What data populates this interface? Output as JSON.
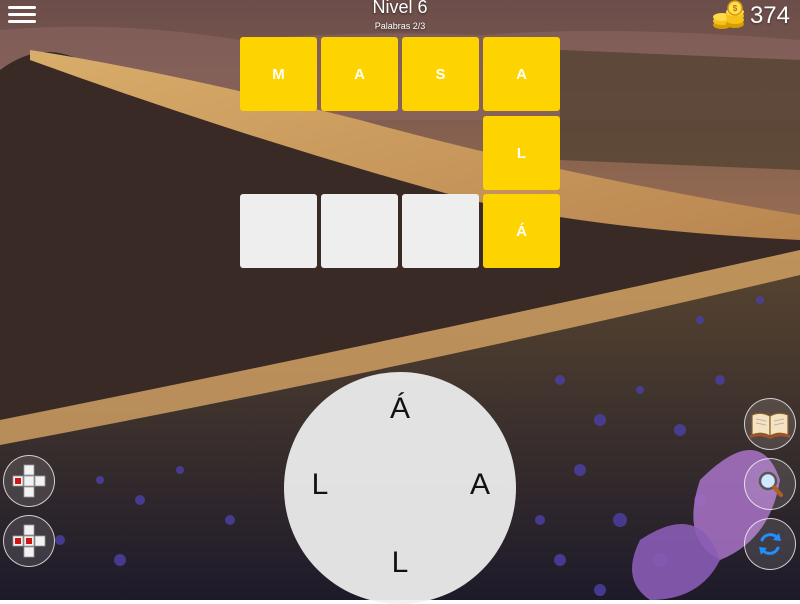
{
  "header": {
    "menu_label": "",
    "level_title": "Nivel 6",
    "progress_text": "Palabras 2/3",
    "coins": "374"
  },
  "grid": {
    "tiles": [
      {
        "letter": "M",
        "state": "filled"
      },
      {
        "letter": "A",
        "state": "filled"
      },
      {
        "letter": "S",
        "state": "filled"
      },
      {
        "letter": "A",
        "state": "filled"
      },
      {
        "letter": "L",
        "state": "filled"
      },
      {
        "letter": "",
        "state": "empty"
      },
      {
        "letter": "",
        "state": "empty"
      },
      {
        "letter": "",
        "state": "empty"
      },
      {
        "letter": "Á",
        "state": "filled"
      }
    ]
  },
  "wheel": {
    "letters": [
      "Á",
      "A",
      "L",
      "L"
    ]
  },
  "left_tools": [
    {
      "name": "reveal-cell-icon"
    },
    {
      "name": "reveal-word-icon"
    }
  ],
  "right_tools": [
    {
      "name": "book-icon"
    },
    {
      "name": "magnifier-icon"
    },
    {
      "name": "shuffle-icon"
    }
  ],
  "colors": {
    "tile_filled": "#fdd300",
    "tile_empty": "#eeeeee",
    "wheel": "#f0f0f0",
    "shuffle": "#1e90ff"
  }
}
